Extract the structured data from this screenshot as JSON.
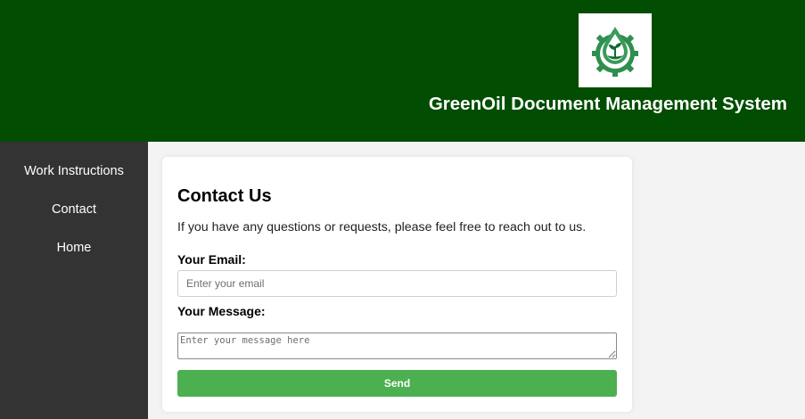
{
  "header": {
    "title": "GreenOil Document Management System",
    "logo_icon": "greenoil-logo-icon",
    "background": "#014d01"
  },
  "sidebar": {
    "background": "#333333",
    "items": [
      {
        "label": "Work Instructions"
      },
      {
        "label": "Contact"
      },
      {
        "label": "Home"
      }
    ]
  },
  "contact": {
    "heading": "Contact Us",
    "intro": "If you have any questions or requests, please feel free to reach out to us.",
    "email_label": "Your Email:",
    "email_placeholder": "Enter your email",
    "message_label": "Your Message:",
    "message_placeholder": "Enter your message here",
    "send_label": "Send",
    "send_color": "#4caf50"
  }
}
